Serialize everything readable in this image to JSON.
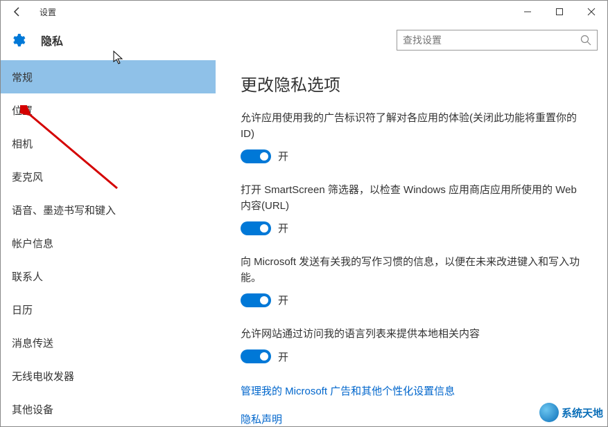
{
  "window": {
    "title": "设置"
  },
  "header": {
    "title": "隐私",
    "search_placeholder": "查找设置"
  },
  "sidebar": {
    "items": [
      {
        "label": "常规",
        "selected": true
      },
      {
        "label": "位置",
        "selected": false
      },
      {
        "label": "相机",
        "selected": false
      },
      {
        "label": "麦克风",
        "selected": false
      },
      {
        "label": "语音、墨迹书写和键入",
        "selected": false
      },
      {
        "label": "帐户信息",
        "selected": false
      },
      {
        "label": "联系人",
        "selected": false
      },
      {
        "label": "日历",
        "selected": false
      },
      {
        "label": "消息传送",
        "selected": false
      },
      {
        "label": "无线电收发器",
        "selected": false
      },
      {
        "label": "其他设备",
        "selected": false
      }
    ]
  },
  "main": {
    "title": "更改隐私选项",
    "options": [
      {
        "desc": "允许应用使用我的广告标识符了解对各应用的体验(关闭此功能将重置你的 ID)",
        "on": true,
        "state": "开"
      },
      {
        "desc": "打开 SmartScreen 筛选器，以检查 Windows 应用商店应用所使用的 Web 内容(URL)",
        "on": true,
        "state": "开"
      },
      {
        "desc": "向 Microsoft 发送有关我的写作习惯的信息，以便在未来改进键入和写入功能。",
        "on": true,
        "state": "开"
      },
      {
        "desc": "允许网站通过访问我的语言列表来提供本地相关内容",
        "on": true,
        "state": "开"
      }
    ],
    "link_manage": "管理我的 Microsoft 广告和其他个性化设置信息",
    "link_privacy": "隐私声明"
  },
  "watermark": {
    "text": "系统天地"
  }
}
